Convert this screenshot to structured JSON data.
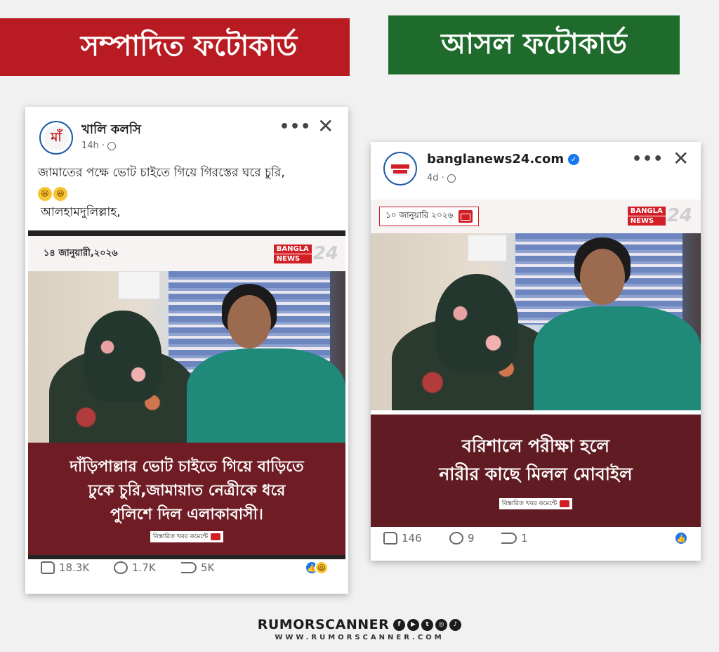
{
  "banners": {
    "edited": "সম্পাদিত ফটোকার্ড",
    "original": "আসল ফটোকার্ড"
  },
  "colors": {
    "edited_banner": "#b81c22",
    "original_banner": "#1f6b2c",
    "caption_bg": "#6f1c24",
    "facebook_blue": "#1877f2"
  },
  "edited_post": {
    "page_name": "খালি কলসি",
    "time": "14h ·",
    "text_line1": "জামাতের পক্ষে ভোট চাইতে গিয়ে গিরস্তের ঘরে চুরি,",
    "text_line3": "আলহামদুলিল্লাহ,",
    "card_date": "১৪ জানুয়ারী,২০২৬",
    "logo_top": "BANGLA",
    "logo_bottom": "NEWS",
    "logo_num": "24",
    "caption_lines": [
      "দাঁড়িপাল্লার ভোট চাইতে গিয়ে বাড়িতে",
      "ঢুকে চুরি,জামায়াত নেত্রীকে ধরে",
      "পুলিশে দিল এলাকাবাসী।"
    ],
    "more_tag": "বিস্তারিত খবর কমেন্টে",
    "likes": "18.3K",
    "comments": "1.7K",
    "shares": "5K"
  },
  "original_post": {
    "page_name": "banglanews24.com",
    "time": "4d ·",
    "card_date": "১০ জানুয়ারি ২০২৬",
    "logo_top": "BANGLA",
    "logo_bottom": "NEWS",
    "logo_num": "24",
    "caption_lines": [
      "বরিশালে পরীক্ষা হলে",
      "নারীর কাছে মিলল মোবাইল"
    ],
    "more_tag": "বিস্তারিত খবর কমেন্টে",
    "likes": "146",
    "comments": "9",
    "shares": "1"
  },
  "footer": {
    "brand": "RUMORSCANNER",
    "url": "WWW.RUMORSCANNER.COM"
  }
}
